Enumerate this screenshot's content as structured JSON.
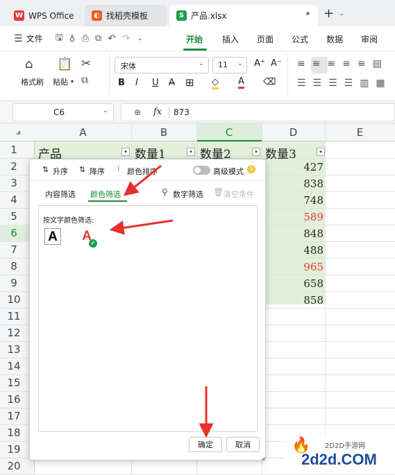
{
  "tabs": [
    {
      "label": "WPS Office"
    },
    {
      "label": "找稻壳模板"
    },
    {
      "label": "产品.xlsx"
    }
  ],
  "menu": {
    "file": "文件",
    "items": [
      "开始",
      "插入",
      "页面",
      "公式",
      "数据",
      "审阅"
    ]
  },
  "ribbon": {
    "format_painter": "格式刷",
    "paste": "粘贴",
    "font_name": "宋体",
    "font_size": "11"
  },
  "formula_bar": {
    "cell_ref": "C6",
    "fx": "fx",
    "value": "873"
  },
  "columns": [
    "A",
    "B",
    "C",
    "D",
    "E"
  ],
  "rows": [
    "1",
    "2",
    "3",
    "4",
    "5",
    "6",
    "7",
    "8",
    "9",
    "10",
    "11",
    "12",
    "13",
    "14",
    "15",
    "16",
    "17",
    "18",
    "19",
    "20"
  ],
  "headers": [
    "产品",
    "数量1",
    "数量2",
    "数量3"
  ],
  "col_d_values": [
    {
      "v": "427",
      "c": "#222222"
    },
    {
      "v": "838",
      "c": "#222222"
    },
    {
      "v": "748",
      "c": "#222222"
    },
    {
      "v": "589",
      "c": "#e53935"
    },
    {
      "v": "848",
      "c": "#222222"
    },
    {
      "v": "488",
      "c": "#222222"
    },
    {
      "v": "965",
      "c": "#e53935"
    },
    {
      "v": "658",
      "c": "#222222"
    },
    {
      "v": "858",
      "c": "#222222"
    }
  ],
  "filter_popup": {
    "sort_asc": "升序",
    "sort_desc": "降序",
    "color_sort": "颜色排序",
    "advanced_mode": "高级模式",
    "tab_content": "内容筛选",
    "tab_color": "颜色筛选",
    "number_filter": "数字筛选",
    "clear": "清空条件",
    "section_label": "按文字颜色筛选:",
    "ok": "确定",
    "cancel": "取消"
  },
  "watermark": {
    "site": "2D2D手游网",
    "domain": "2d2d.COM"
  },
  "colors": {
    "accent_green": "#1b8a3a",
    "selection": "#e2f0d9",
    "red_text": "#e53935",
    "arrow_red": "#e8302c"
  }
}
